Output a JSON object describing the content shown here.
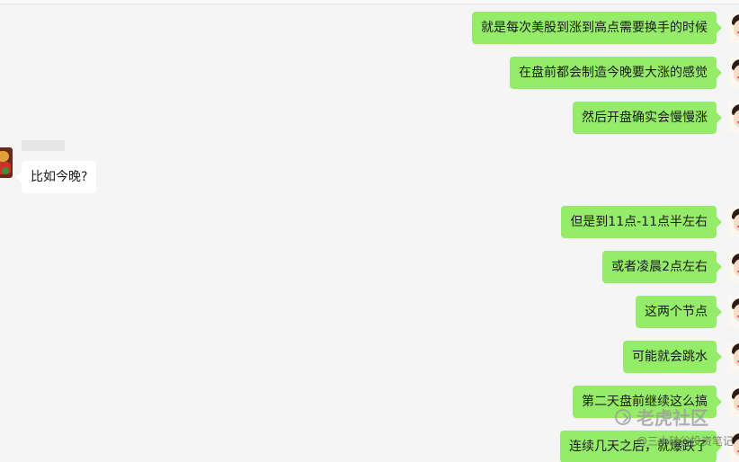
{
  "conversation": {
    "incoming_sender_name": "",
    "messages": [
      {
        "side": "out",
        "text": "就是每次美股到涨到高点需要换手的时候"
      },
      {
        "side": "out",
        "text": "在盘前都会制造今晚要大涨的感觉"
      },
      {
        "side": "out",
        "text": "然后开盘确实会慢慢涨"
      },
      {
        "side": "in",
        "text": "比如今晚?"
      },
      {
        "side": "out",
        "text": "但是到11点-11点半左右"
      },
      {
        "side": "out",
        "text": "或者凌晨2点左右"
      },
      {
        "side": "out",
        "text": "这两个节点"
      },
      {
        "side": "out",
        "text": "可能就会跳水"
      },
      {
        "side": "out",
        "text": "第二天盘前继续这么搞"
      },
      {
        "side": "out",
        "text": "连续几天之后，就爆跌了"
      }
    ]
  },
  "watermark": {
    "brand": "老虎社区",
    "author": "@三木硅谷投资笔记"
  },
  "colors": {
    "outgoing_bubble": "#95ec69",
    "incoming_bubble": "#ffffff",
    "background": "#f5f5f5"
  },
  "icons": {
    "my_avatar": "cartoon-boy-avatar",
    "other_avatar": "colorful-cartoon-avatar",
    "watermark_logo": "tiger-community-logo"
  }
}
